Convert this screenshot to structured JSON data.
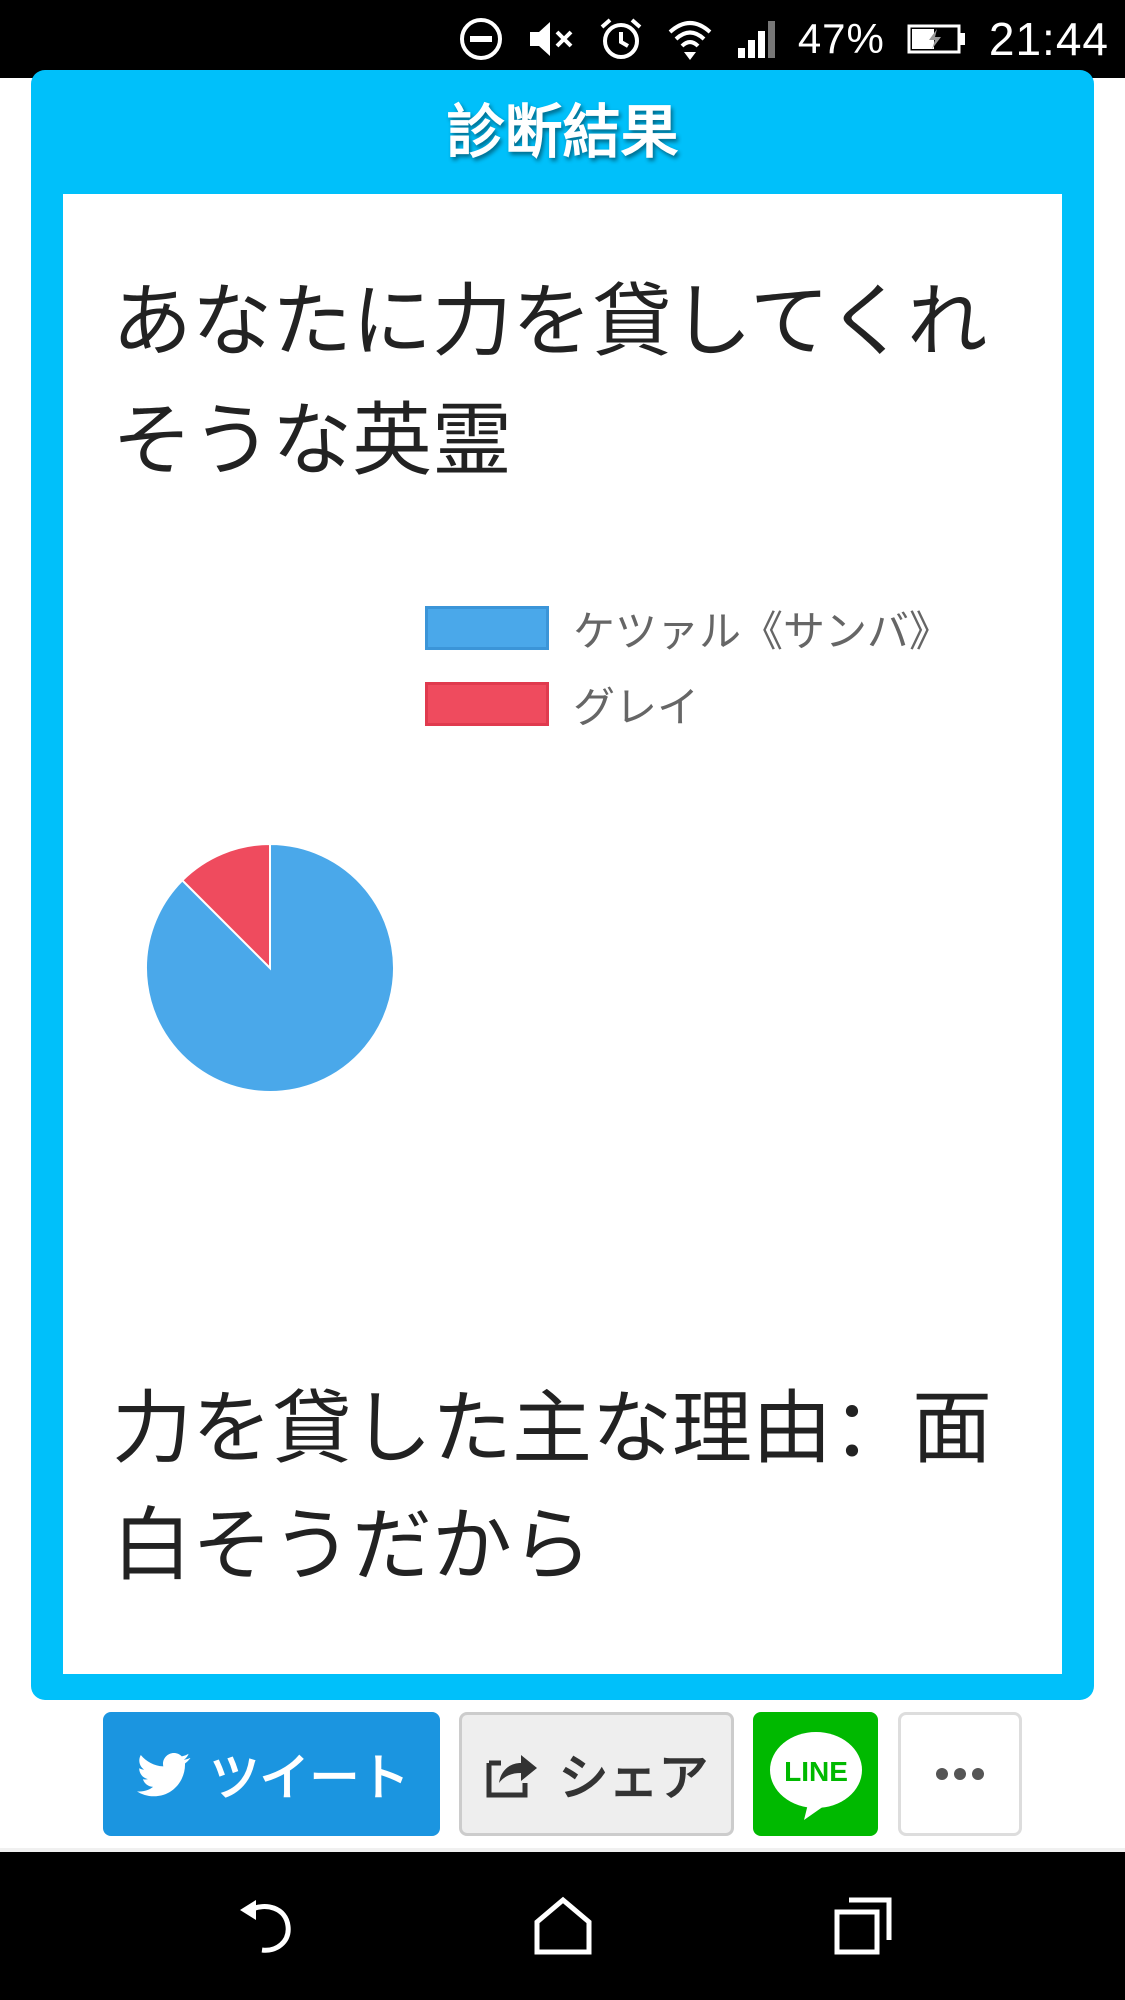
{
  "status_bar": {
    "icons": [
      "do-not-disturb-icon",
      "mute-icon",
      "alarm-icon",
      "wifi-icon",
      "signal-icon",
      "battery-charging-icon"
    ],
    "battery_percent": "47%",
    "time": "21:44"
  },
  "card": {
    "title": "診断結果",
    "heading": "あなたに力を貸してくれそうな英霊",
    "reason": "力を貸した主な理由：面白そうだから"
  },
  "colors": {
    "card_border": "#00c0fa",
    "series_1": "#4aa8ea",
    "series_2": "#ef4b5e",
    "tweet": "#1b95e0",
    "line": "#00b900"
  },
  "chart_data": {
    "type": "pie",
    "title": "",
    "legend_position": "top-right",
    "series": [
      {
        "name": "ケツァル《サンバ》",
        "value": 87.5
      },
      {
        "name": "グレイ",
        "value": 12.5
      }
    ]
  },
  "share_buttons": {
    "tweet_label": "ツイート",
    "share_label": "シェア",
    "line_label": "LINE"
  },
  "nav_bar": {
    "buttons": [
      "back-icon",
      "home-icon",
      "recents-icon"
    ]
  }
}
